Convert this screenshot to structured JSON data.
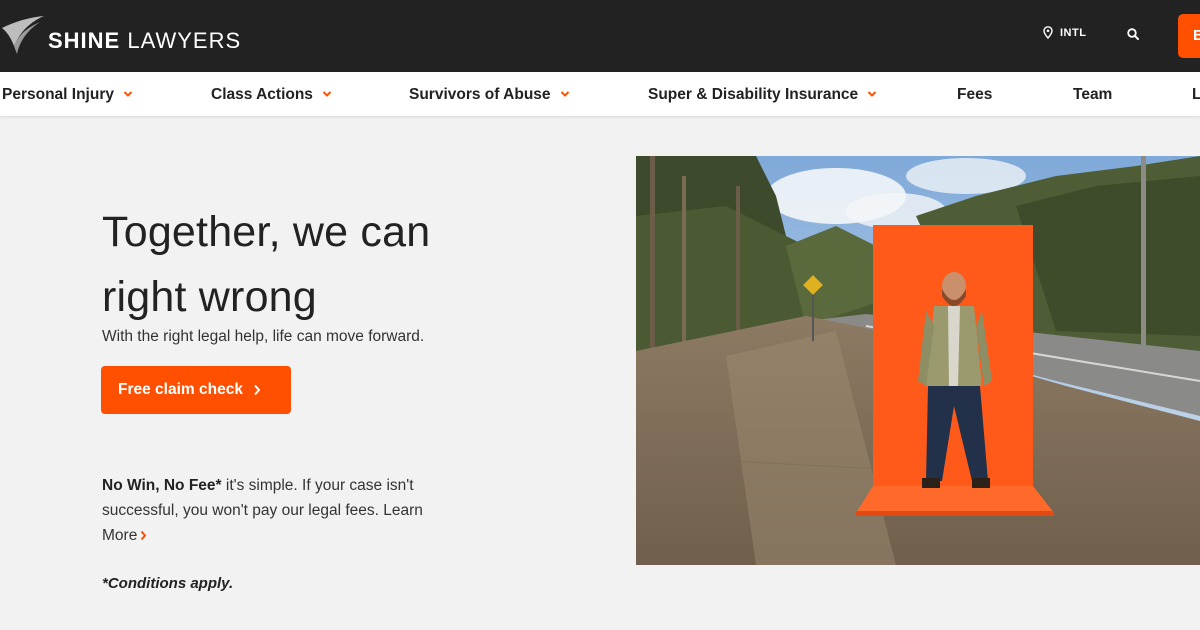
{
  "brand": {
    "logo_bold": "SHINE",
    "logo_light": "LAWYERS"
  },
  "topbar": {
    "intl_label": "INTL",
    "cta_label": "B"
  },
  "nav": {
    "items": [
      {
        "label": "Personal Injury",
        "dropdown": true
      },
      {
        "label": "Class Actions",
        "dropdown": true
      },
      {
        "label": "Survivors of Abuse",
        "dropdown": true
      },
      {
        "label": "Super & Disability Insurance",
        "dropdown": true
      },
      {
        "label": "Fees",
        "dropdown": false
      },
      {
        "label": "Team",
        "dropdown": false
      },
      {
        "label": "L",
        "dropdown": false
      }
    ]
  },
  "hero": {
    "headline": "Together, we can right wrong",
    "subtitle": "With the right legal help, life can move forward.",
    "cta_label": "Free claim check",
    "nowin_bold": "No Win, No Fee*",
    "nowin_text": " it's simple. If your case isn't successful, you won't pay our legal fees.",
    "learn_more": "Learn More",
    "conditions": "*Conditions apply."
  },
  "colors": {
    "accent": "#ff4f00",
    "topbar": "#222222",
    "page_bg": "#f2f2f3"
  },
  "icons": [
    "shine-wing-logo-icon",
    "location-pin-icon",
    "search-icon",
    "chevron-down-icon",
    "chevron-right-icon"
  ]
}
